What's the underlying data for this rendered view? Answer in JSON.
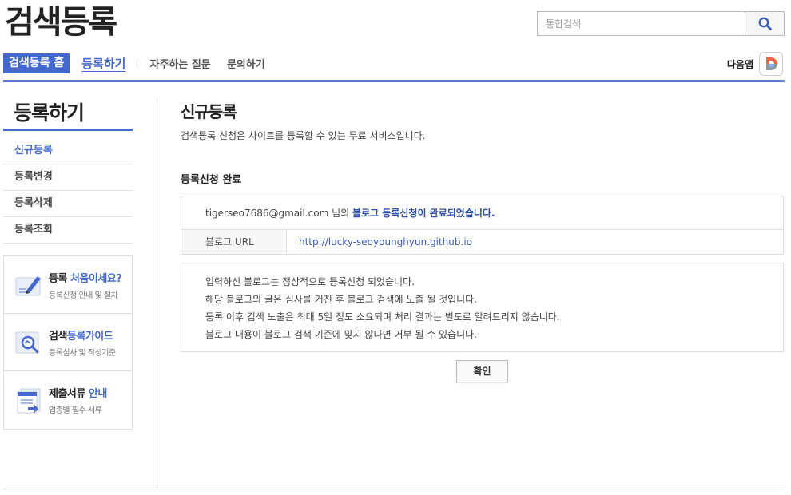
{
  "header": {
    "logo": "검색등록",
    "search_placeholder": "통합검색",
    "search_icon": "search-icon"
  },
  "nav": {
    "home": "검색등록 홈",
    "active": "등록하기",
    "items": [
      "자주하는 질문",
      "문의하기"
    ],
    "daum_app": "다음앱",
    "daum_icon": "daum-d-icon"
  },
  "sidebar": {
    "title": "등록하기",
    "items": [
      {
        "label": "신규등록",
        "active": true
      },
      {
        "label": "등록변경",
        "active": false
      },
      {
        "label": "등록삭제",
        "active": false
      },
      {
        "label": "등록조회",
        "active": false
      }
    ],
    "promos": [
      {
        "title_plain": "등록 ",
        "title_hl": "처음이세요?",
        "sub": "등록신청 안내 및 절차",
        "icon": "pen-card-icon"
      },
      {
        "title_plain": "검색",
        "title_hl": "등록가이드",
        "sub": "등록심사 및 작성기준",
        "icon": "magnify-guide-icon"
      },
      {
        "title_plain": "제출서류 ",
        "title_hl": "안내",
        "sub": "업종별 필수 서류",
        "icon": "document-stack-icon"
      }
    ]
  },
  "main": {
    "title": "신규등록",
    "description": "검색등록 신청은 사이트를 등록할 수 있는 무료 서비스입니다.",
    "section_title": "등록신청 완료",
    "result": {
      "email": "tigerseo7686@gmail.com",
      "suffix": " 님의 ",
      "done_text": "블로그 등록신청이 완료되었습니다.",
      "url_label": "블로그 URL",
      "url_value": "http://lucky-seoyounghyun.github.io"
    },
    "notice": [
      "입력하신 블로그는 정상적으로 등록신청 되었습니다.",
      "해당 블로그의 글은 심사를 거친 후 블로그 검색에 노출 될 것입니다.",
      "등록 이후 검색 노출은 최대 5일 정도 소요되며 처리 결과는 별도로 알려드리지 않습니다.",
      "블로그 내용이 블로그 검색 기준에 맞지 않다면 거부 될 수 있습니다."
    ],
    "confirm_button": "확인"
  },
  "colors": {
    "accent": "#4568cf",
    "link": "#3b5cb8"
  }
}
